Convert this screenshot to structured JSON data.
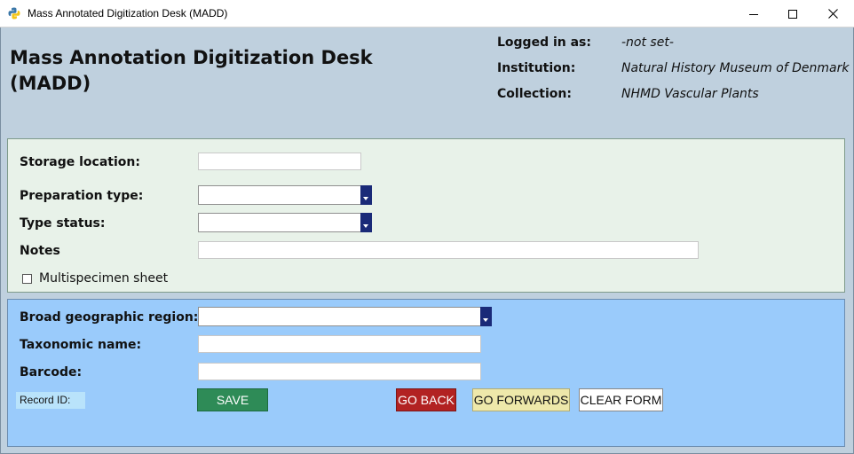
{
  "window": {
    "title": "Mass Annotated Digitization Desk (MADD)",
    "icon": "python-icon"
  },
  "header": {
    "app_title": "Mass Annotation Digitization Desk (MADD)",
    "logged_in_label": "Logged in as:",
    "logged_in_value": "-not set-",
    "institution_label": "Institution:",
    "institution_value": "Natural History Museum of Denmark",
    "collection_label": "Collection:",
    "collection_value": "NHMD Vascular Plants"
  },
  "form1": {
    "storage_label": "Storage location:",
    "storage_value": "",
    "preparation_label": "Preparation type:",
    "preparation_value": "",
    "type_status_label": "Type status:",
    "type_status_value": "",
    "notes_label": "Notes",
    "notes_value": "",
    "multispecimen_label": "Multispecimen sheet",
    "multispecimen_checked": false
  },
  "form2": {
    "region_label": "Broad geographic region:",
    "region_value": "",
    "taxon_label": "Taxonomic name:",
    "taxon_value": "",
    "barcode_label": "Barcode:",
    "barcode_value": "",
    "record_id_label": "Record ID:"
  },
  "buttons": {
    "save": "SAVE",
    "go_back": "GO BACK",
    "go_forwards": "GO FORWARDS",
    "clear_form": "CLEAR FORM"
  },
  "colors": {
    "header_bg": "#bfd0de",
    "panel1_bg": "#e8f2e9",
    "panel2_bg": "#9acbfb",
    "save_bg": "#2e8b57",
    "back_bg": "#b22222",
    "forwards_bg": "#eee8aa",
    "dropdown_button": "#1a2a78"
  }
}
